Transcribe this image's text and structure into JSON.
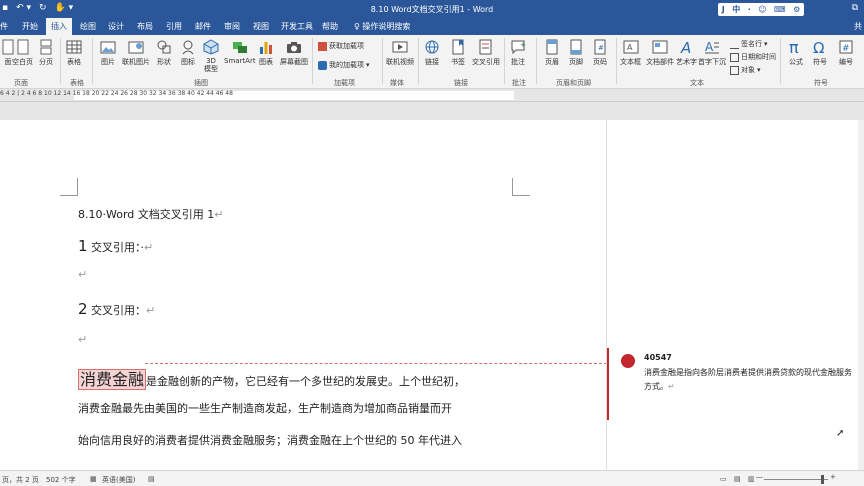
{
  "titlebar": {
    "title": "8.10 Word文档交叉引用1 - Word",
    "ime": [
      "中",
      "J",
      "·",
      "☺",
      "⌨",
      "⚙"
    ],
    "window_controls": "⧉"
  },
  "tabs": {
    "items": [
      "件",
      "开始",
      "插入",
      "绘图",
      "设计",
      "布局",
      "引用",
      "邮件",
      "审阅",
      "视图",
      "开发工具",
      "帮助"
    ],
    "active": "插入",
    "tell_me": "操作说明搜索",
    "share": "共"
  },
  "ribbon": {
    "pages": {
      "items": [
        "面",
        "空白页",
        "分页"
      ],
      "label": "页面"
    },
    "tables": {
      "items": [
        "表格"
      ],
      "label": "表格"
    },
    "illustrations": {
      "items": [
        "图片",
        "联机图片",
        "形状",
        "图标",
        "3D 模型",
        "SmartArt",
        "图表",
        "屏幕截图"
      ],
      "label": "插图"
    },
    "addins": {
      "items": [
        "获取加载项",
        "我的加载项"
      ],
      "label": "加载项"
    },
    "media": {
      "items": [
        "联机视频"
      ],
      "label": "媒体"
    },
    "links": {
      "items": [
        "链接",
        "书签",
        "交叉引用"
      ],
      "label": "链接"
    },
    "comments": {
      "items": [
        "批注"
      ],
      "label": "批注"
    },
    "header_footer": {
      "items": [
        "页眉",
        "页脚",
        "页码"
      ],
      "label": "页眉和页脚"
    },
    "text": {
      "items": [
        "文本框",
        "文档部件",
        "艺术字",
        "首字下沉"
      ],
      "small": [
        "签名行",
        "日期和时间",
        "对象"
      ],
      "label": "文本"
    },
    "symbols": {
      "items": [
        "公式",
        "符号",
        "编号"
      ],
      "label": "符号"
    }
  },
  "ruler": {
    "ticks": "6  4  2  |  2  4  6  8  10  12  14  16  18  20  22  24  26  28  30  32  34  36  38  40  42  44  46  48"
  },
  "document": {
    "title_line": "8.10·Word 文档交叉引用 1",
    "para_mark": "↵",
    "heading1": {
      "num": "1",
      "text": " 交叉引用：·"
    },
    "heading2": {
      "num": "2",
      "text": " 交叉引用："
    },
    "highlighted": "消费金融",
    "body1_rest": "是金融创新的产物，它已经有一个多世纪的发展史。上个世纪初，",
    "body2": "消费金融最先由美国的一些生产制造商发起，生产制造商为增加商品销量而开",
    "body3": "始向信用良好的消费者提供消费金融服务；消费金融在上个世纪的 50 年代进入"
  },
  "comment": {
    "author": "40547",
    "text": "消费金融是指向各阶层消费者提供消费贷款的现代金融服务方式。"
  },
  "statusbar": {
    "page": "页，共 2 页",
    "words": "502 个字",
    "language": "英语(美国)",
    "zoom_minus": "—",
    "zoom_plus": "+"
  },
  "colors": {
    "brand": "#2b579a",
    "comment_accent": "#c4262e",
    "highlight": "#f6d4d4"
  }
}
